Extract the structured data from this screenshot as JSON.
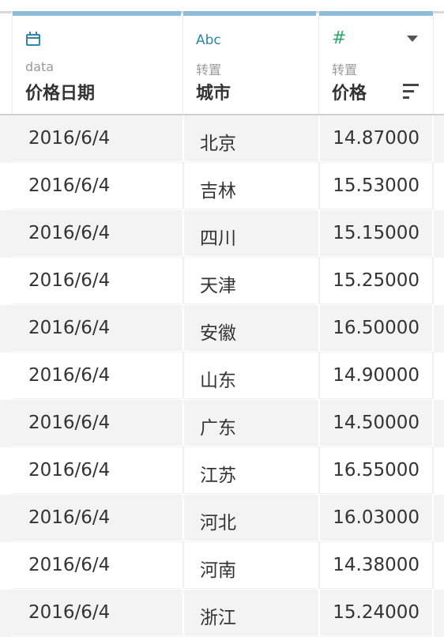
{
  "columns": [
    {
      "type_icon": "calendar-icon",
      "origin": "data",
      "name": "价格日期"
    },
    {
      "type_icon": "abc-string-icon",
      "type_label": "Abc",
      "origin": "转置",
      "name": "城市"
    },
    {
      "type_icon": "hash-number-icon",
      "type_label": "#",
      "origin": "转置",
      "name": "价格"
    }
  ],
  "rows": [
    {
      "date": "2016/6/4",
      "city": "北京",
      "price": "14.87000"
    },
    {
      "date": "2016/6/4",
      "city": "吉林",
      "price": "15.53000"
    },
    {
      "date": "2016/6/4",
      "city": "四川",
      "price": "15.15000"
    },
    {
      "date": "2016/6/4",
      "city": "天津",
      "price": "15.25000"
    },
    {
      "date": "2016/6/4",
      "city": "安徽",
      "price": "16.50000"
    },
    {
      "date": "2016/6/4",
      "city": "山东",
      "price": "14.90000"
    },
    {
      "date": "2016/6/4",
      "city": "广东",
      "price": "14.50000"
    },
    {
      "date": "2016/6/4",
      "city": "江苏",
      "price": "16.55000"
    },
    {
      "date": "2016/6/4",
      "city": "河北",
      "price": "16.03000"
    },
    {
      "date": "2016/6/4",
      "city": "河南",
      "price": "14.38000"
    },
    {
      "date": "2016/6/4",
      "city": "浙江",
      "price": "15.24000"
    }
  ],
  "colors": {
    "header_cap": "#8fbcd9",
    "date_icon": "#2f86a6",
    "string_icon": "#2f86a6",
    "number_icon": "#2ea56c",
    "alt_row": "#f3f3f3"
  }
}
